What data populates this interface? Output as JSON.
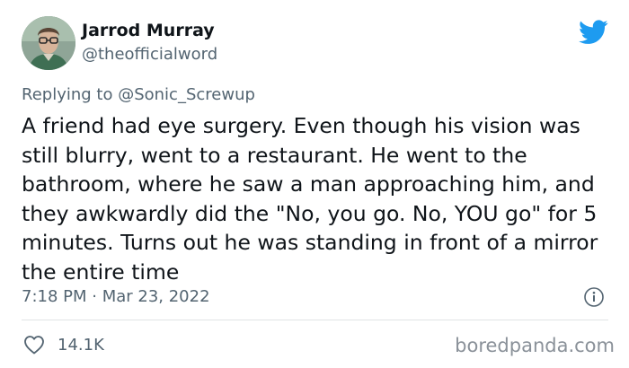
{
  "author": {
    "display_name": "Jarrod Murray",
    "handle": "@theofficialword"
  },
  "reply": {
    "prefix": "Replying to ",
    "mention": "@Sonic_Screwup"
  },
  "tweet": {
    "text": "A friend had eye surgery. Even though his vision was still blurry, went to a restaurant. He went to the bathroom, where he saw a man approaching him, and they awkwardly did the \"No, you go. No, YOU go\" for 5 minutes. Turns out he was standing in front of a mirror the entire time",
    "timestamp": "7:18 PM · Mar 23, 2022"
  },
  "engagement": {
    "likes": "14.1K"
  },
  "watermark": "boredpanda.com",
  "icons": {
    "brand": "twitter-bird-icon",
    "info": "info-icon",
    "like": "heart-icon"
  },
  "colors": {
    "twitter_blue": "#1d9bf0",
    "text_primary": "#0f1419",
    "text_secondary": "#536471",
    "divider": "#e1e4e6"
  }
}
